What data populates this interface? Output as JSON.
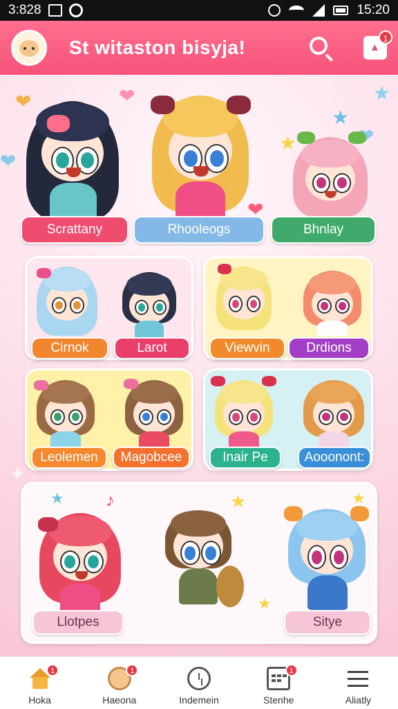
{
  "status_bar": {
    "time_left": "3:828",
    "time_right": "15:20"
  },
  "header": {
    "title": "St witaston bisyja!",
    "notification_count": "1"
  },
  "featured": [
    {
      "label": "Scrattany",
      "color": "#ee4d6f"
    },
    {
      "label": "Rhooleogs",
      "color": "#84b8e6"
    },
    {
      "label": "Bhnlay",
      "color": "#3faa6b"
    }
  ],
  "grid_cards": [
    {
      "labels": [
        "Cirnok",
        "Larot"
      ],
      "colors": [
        "#f2862f",
        "#ea3f6a"
      ]
    },
    {
      "labels": [
        "Viewvin",
        "Drdions"
      ],
      "colors": [
        "#f08a2a",
        "#a33fc6"
      ]
    },
    {
      "labels": [
        "Leolemen",
        "Magobcee"
      ],
      "colors": [
        "#f4892d",
        "#f3702e"
      ]
    },
    {
      "labels": [
        "Inair Pe",
        "Aooonont:"
      ],
      "colors": [
        "#2cb38e",
        "#3a8fd8"
      ]
    }
  ],
  "bottom_card": {
    "labels": [
      "Llotpes",
      "Sitye"
    ]
  },
  "bottom_nav": [
    {
      "label": "Hoka",
      "icon": "home-icon",
      "badge": "1"
    },
    {
      "label": "Haeona",
      "icon": "character-icon",
      "badge": "1"
    },
    {
      "label": "Indemein",
      "icon": "clock-icon",
      "badge": ""
    },
    {
      "label": "Stenhe",
      "icon": "calendar-icon",
      "badge": "1"
    },
    {
      "label": "Aliatly",
      "icon": "menu-icon",
      "badge": ""
    }
  ],
  "colors": {
    "header": "#f7527a",
    "background": "#fbd3df"
  }
}
